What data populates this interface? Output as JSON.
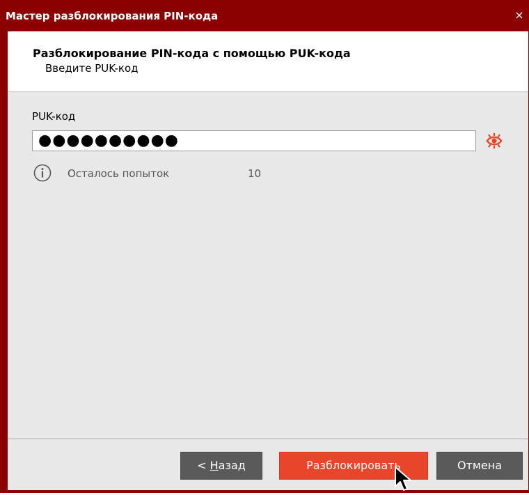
{
  "window": {
    "title": "Мастер разблокирования PIN-кода",
    "close_symbol": "×"
  },
  "header": {
    "title": "Разблокирование PIN-кода с помощью PUK-кода",
    "subtitle": "Введите PUK-код"
  },
  "form": {
    "puk_label": "PUK-код",
    "puk_masked_value": "●●●●●●●●●●",
    "attempts_label": "Осталось попыток",
    "attempts_value": "10"
  },
  "buttons": {
    "back_prefix": "< ",
    "back_mnemonic": "Н",
    "back_rest": "азад",
    "unlock": "Разблокировать",
    "cancel": "Отмена"
  },
  "icons": {
    "eye": "eye-crossed-icon",
    "info": "info-icon",
    "cursor": "mouse-pointer-icon"
  },
  "colors": {
    "titlebar": "#8b0000",
    "accent": "#e8452a",
    "neutral_button": "#5a5a5a",
    "panel_bg": "#e8e8e8"
  }
}
